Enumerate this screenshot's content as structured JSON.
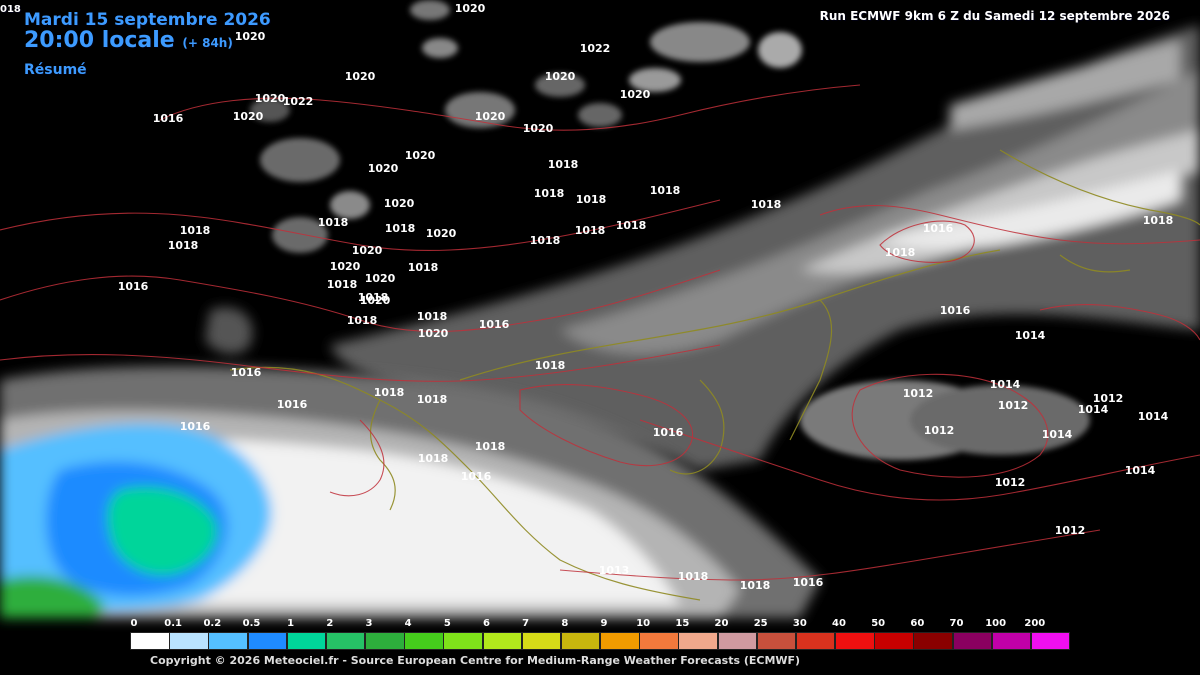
{
  "header": {
    "date": "Mardi 15 septembre 2026",
    "time": "20:00 locale",
    "lead": "(+ 84h)",
    "summary": "Résumé",
    "run": "Run ECMWF 9km 6 Z du Samedi 12 septembre 2026",
    "edge_label": "018"
  },
  "pressure_labels": [
    "1020",
    "1020",
    "1020",
    "1022",
    "1020",
    "1020",
    "1020",
    "1022",
    "1020",
    "1020",
    "1016",
    "1020",
    "1018",
    "1020",
    "1018",
    "1018",
    "1018",
    "1018",
    "1018",
    "1018",
    "1020",
    "1020",
    "1018",
    "1018",
    "1018",
    "1018",
    "1020",
    "1018",
    "1018",
    "1020",
    "1018",
    "1020",
    "1018",
    "1020",
    "1018",
    "1016",
    "1016",
    "1018",
    "1018",
    "1018",
    "1016",
    "1016",
    "1018",
    "1018",
    "1016",
    "1018",
    "1016",
    "1018",
    "1016",
    "1016",
    "1014",
    "1014",
    "1012",
    "1012",
    "1012",
    "1014",
    "1014",
    "1014",
    "1012",
    "1014",
    "1016",
    "1012",
    "1012",
    "1013",
    "1018",
    "1018",
    "1016",
    "1020",
    "1020",
    "1018"
  ],
  "legend": {
    "labels": [
      "0",
      "0.1",
      "0.2",
      "0.5",
      "1",
      "2",
      "3",
      "4",
      "5",
      "6",
      "7",
      "8",
      "9",
      "10",
      "15",
      "20",
      "25",
      "30",
      "40",
      "50",
      "60",
      "70",
      "100",
      "200"
    ],
    "colors": [
      "#ffffff",
      "#b9e3ff",
      "#55bfff",
      "#1f8bff",
      "#00d59a",
      "#26c266",
      "#2dae3c",
      "#45cc1c",
      "#7fe21a",
      "#b2e81c",
      "#d6db18",
      "#c8b60e",
      "#f19b00",
      "#f2793c",
      "#f0a88c",
      "#d09aa0",
      "#c8503c",
      "#d8321e",
      "#ee1010",
      "#c80000",
      "#8a0000",
      "#8a0060",
      "#c000a8",
      "#f00ff0"
    ]
  },
  "footer": {
    "copyright": "Copyright © 2026 Meteociel.fr - Source European Centre for Medium-Range Weather Forecasts (ECMWF)"
  },
  "colors": {
    "background": "#000000",
    "isobar": "#c0303a",
    "coastline": "#8f8a22",
    "header_blue": "#3d9bff"
  }
}
